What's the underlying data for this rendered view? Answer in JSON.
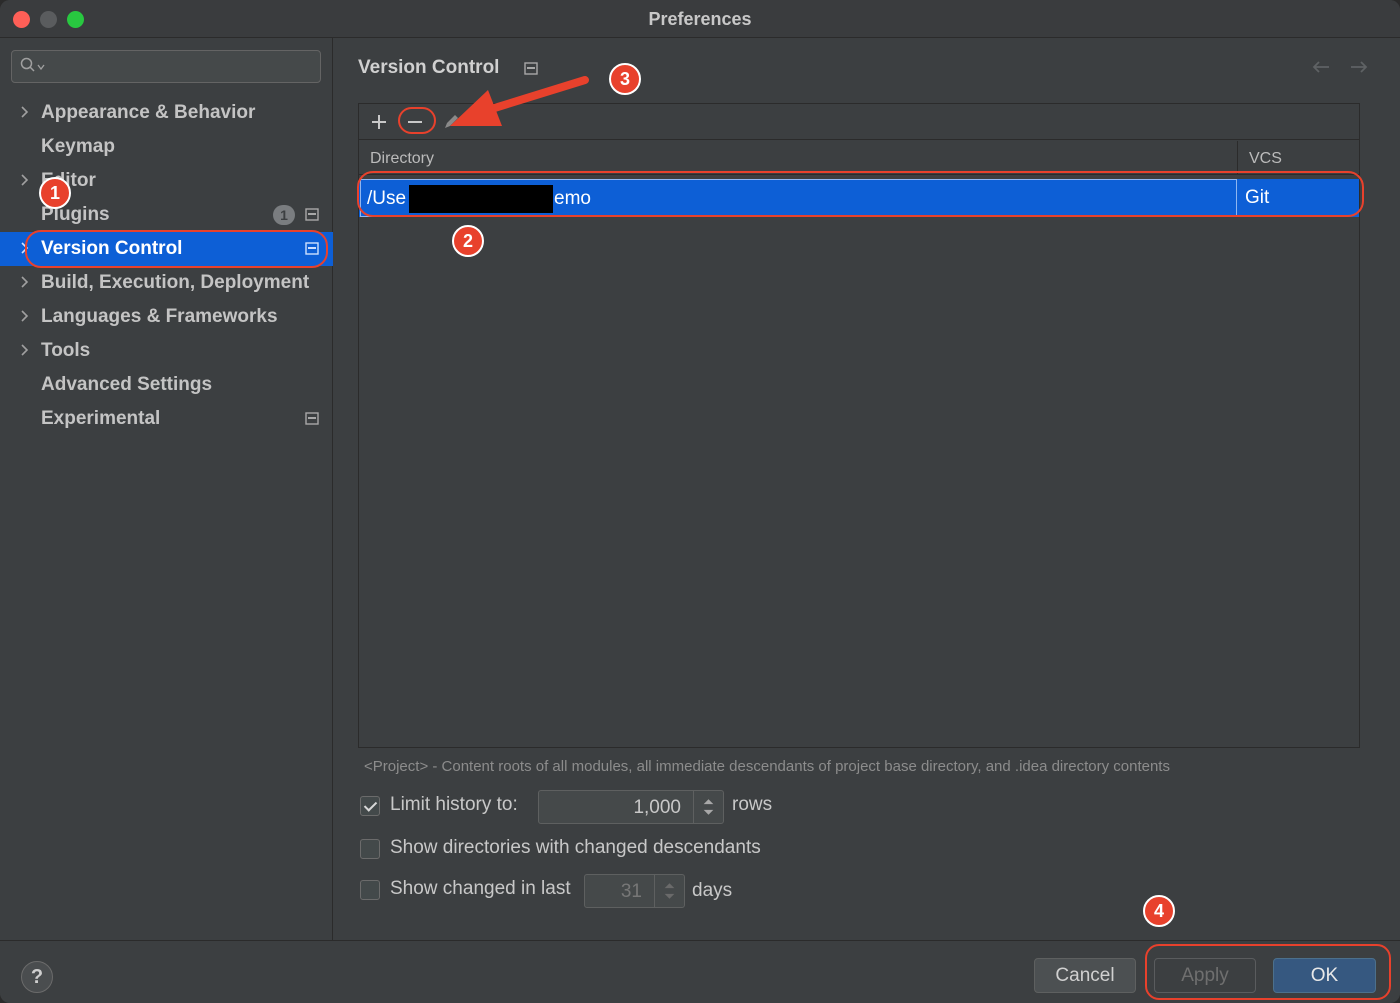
{
  "window": {
    "title": "Preferences"
  },
  "sidebar": {
    "search": {
      "placeholder": ""
    },
    "items": [
      {
        "label": "Appearance & Behavior",
        "expandable": true
      },
      {
        "label": "Keymap",
        "expandable": false
      },
      {
        "label": "Editor",
        "expandable": true
      },
      {
        "label": "Plugins",
        "expandable": false,
        "badge": "1"
      },
      {
        "label": "Version Control",
        "expandable": true,
        "selected": true
      },
      {
        "label": "Build, Execution, Deployment",
        "expandable": true
      },
      {
        "label": "Languages & Frameworks",
        "expandable": true
      },
      {
        "label": "Tools",
        "expandable": true
      },
      {
        "label": "Advanced Settings",
        "expandable": false
      },
      {
        "label": "Experimental",
        "expandable": false
      }
    ]
  },
  "main": {
    "title": "Version Control",
    "table": {
      "columns": [
        "Directory",
        "VCS"
      ],
      "rows": [
        {
          "directory_start": "/Use",
          "directory_end": "emo",
          "vcs": "Git"
        }
      ]
    },
    "hint": "<Project> - Content roots of all modules, all immediate descendants of project base directory, and .idea directory contents",
    "options": {
      "limit_history": {
        "label": "Limit history to:",
        "checked": true,
        "value": "1,000",
        "unit": "rows"
      },
      "show_dirs": {
        "label": "Show directories with changed descendants",
        "checked": false
      },
      "show_changed": {
        "label": "Show changed in last",
        "checked": false,
        "value": "31",
        "unit": "days"
      }
    }
  },
  "footer": {
    "help_label": "?",
    "cancel_label": "Cancel",
    "apply_label": "Apply",
    "ok_label": "OK"
  },
  "annotations": {
    "step_labels": [
      "1",
      "2",
      "3",
      "4"
    ],
    "color": "#e8412c"
  },
  "colors": {
    "selection": "#0d5fd6",
    "background": "#3c3f41",
    "ok_button": "#365880"
  }
}
